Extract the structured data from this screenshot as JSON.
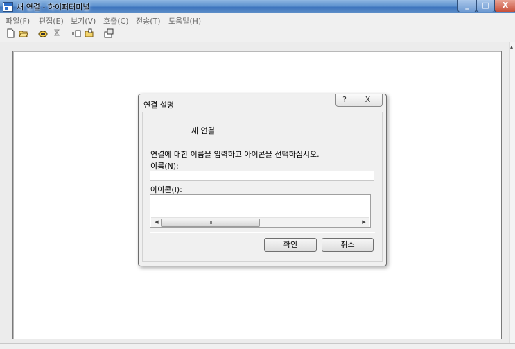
{
  "window": {
    "title": "새 연결 - 하이퍼터미널",
    "controls": {
      "minimize": "_",
      "maximize": "□",
      "close": "X"
    }
  },
  "menu": {
    "items": [
      "파일(F)",
      "편집(E)",
      "보기(V)",
      "호출(C)",
      "전송(T)",
      "도움말(H)"
    ]
  },
  "toolbar": {
    "icons": [
      "new-icon",
      "open-icon",
      "connect-icon",
      "disconnect-icon",
      "send-icon",
      "receive-icon",
      "properties-icon"
    ]
  },
  "dialog": {
    "title": "연결 설명",
    "help_label": "?",
    "close_label": "X",
    "connection_name": "새 연결",
    "instruction": "연결에 대한 이름을 입력하고 아이콘을 선택하십시오.",
    "name_label": "이름(N):",
    "name_value": "",
    "icon_label": "아이콘(I):",
    "scroll_thumb": "III",
    "ok_label": "확인",
    "cancel_label": "취소"
  },
  "colors": {
    "titlebar": "#5f93cf",
    "dialog_bg": "#f0f0f0",
    "terminal_bg": "#ffffff"
  }
}
